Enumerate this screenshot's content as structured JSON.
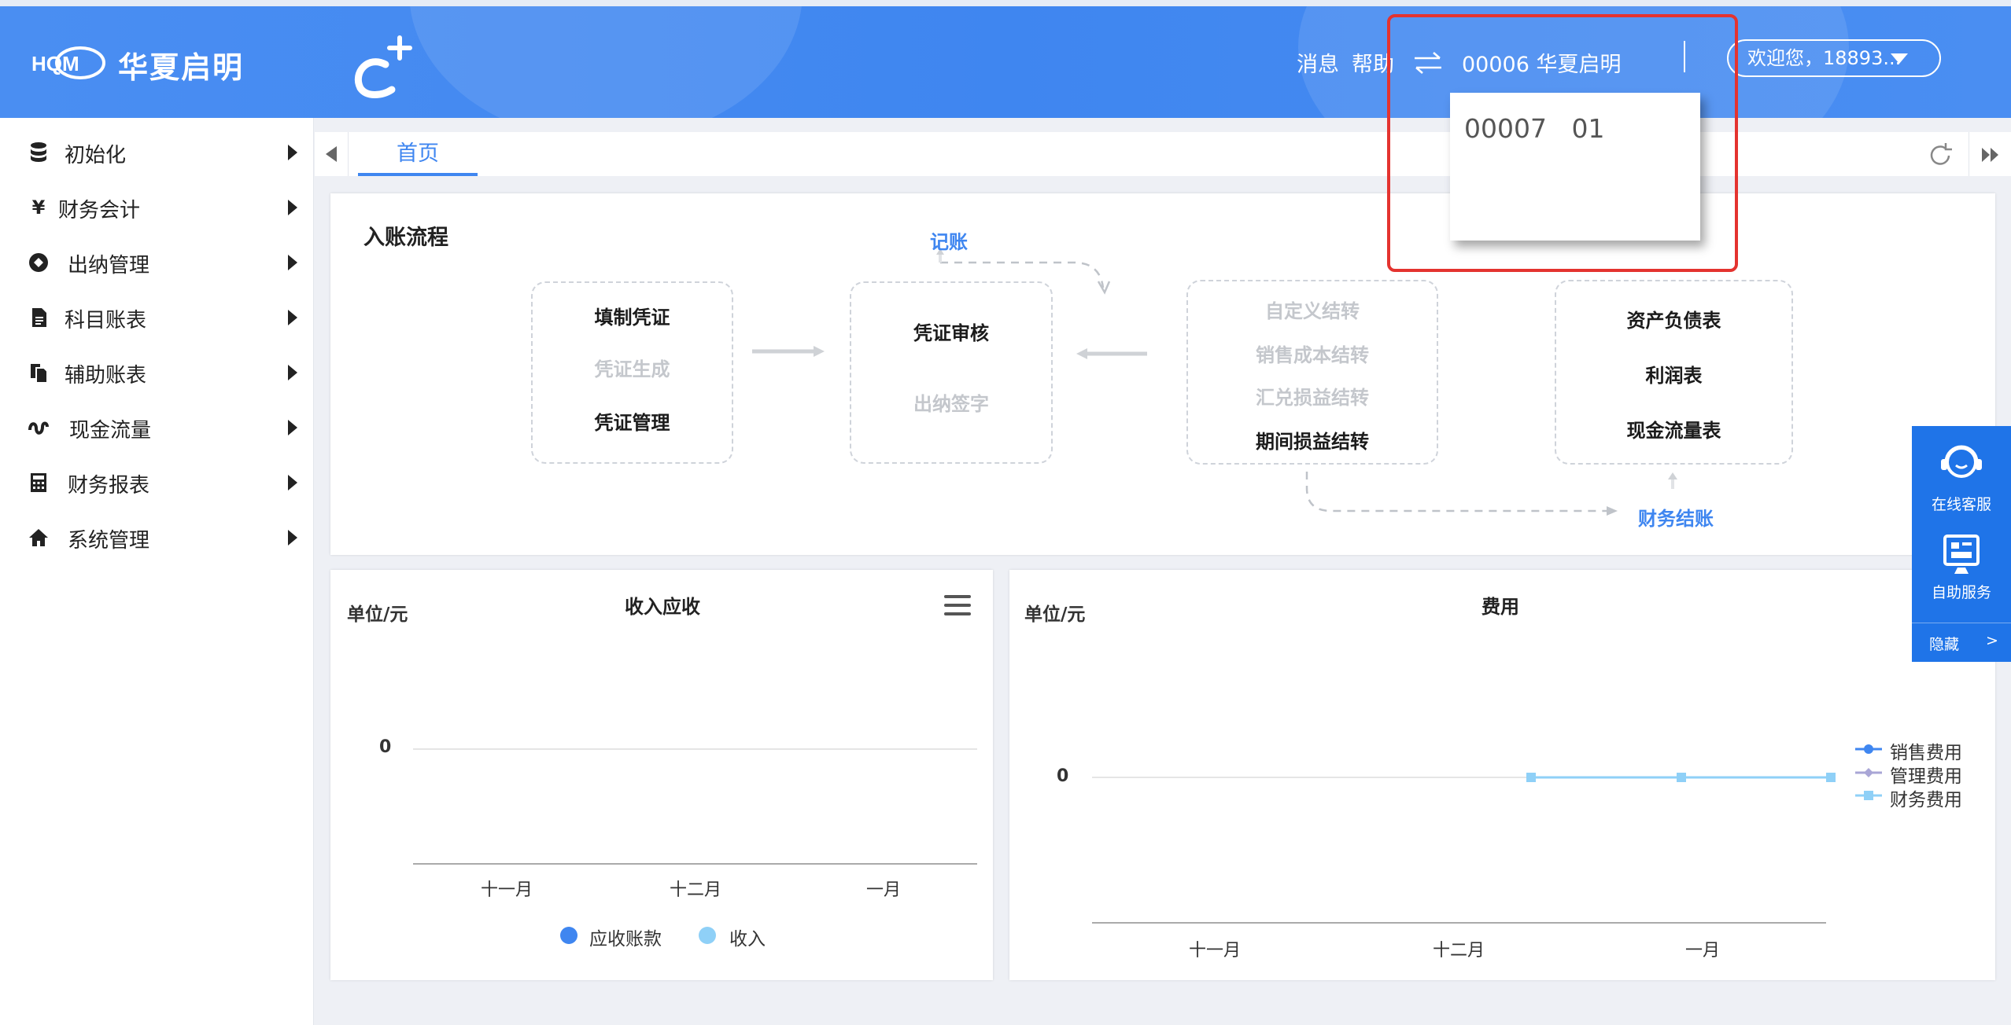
{
  "header": {
    "logo_text": "华夏启明",
    "logo_mark_text": "HQM",
    "links": [
      "消息",
      "帮助"
    ],
    "switch_icon": "swap-arrows-icon",
    "current_account": "00006 华夏启明",
    "welcome_label": "欢迎您，18893..."
  },
  "account_dropdown": {
    "options": [
      "00007   01"
    ]
  },
  "sidebar": {
    "items": [
      {
        "label": "初始化",
        "icon": "database-icon"
      },
      {
        "label": "财务会计",
        "icon": "yen-icon"
      },
      {
        "label": "出纳管理",
        "icon": "cashier-icon"
      },
      {
        "label": "科目账表",
        "icon": "document-icon"
      },
      {
        "label": "辅助账表",
        "icon": "copy-icon"
      },
      {
        "label": "现金流量",
        "icon": "flow-icon"
      },
      {
        "label": "财务报表",
        "icon": "calculator-icon"
      },
      {
        "label": "系统管理",
        "icon": "home-icon"
      }
    ]
  },
  "tabs": {
    "items": [
      "首页"
    ],
    "active": 0
  },
  "flow": {
    "title": "入账流程",
    "box1": {
      "items": [
        {
          "label": "填制凭证",
          "active": true
        },
        {
          "label": "凭证生成",
          "active": false
        },
        {
          "label": "凭证管理",
          "active": true
        }
      ]
    },
    "box2": {
      "items": [
        {
          "label": "凭证审核",
          "active": true
        },
        {
          "label": "出纳签字",
          "active": false
        }
      ]
    },
    "box3": {
      "items": [
        {
          "label": "自定义结转",
          "active": false
        },
        {
          "label": "销售成本结转",
          "active": false
        },
        {
          "label": "汇兑损益结转",
          "active": false
        },
        {
          "label": "期间损益结转",
          "active": true
        }
      ]
    },
    "box4": {
      "items": [
        {
          "label": "资产负债表",
          "active": true
        },
        {
          "label": "利润表",
          "active": true
        },
        {
          "label": "现金流量表",
          "active": true
        }
      ]
    },
    "link_record": "记账",
    "link_close": "财务结账"
  },
  "chart_data": [
    {
      "type": "bar",
      "title": "收入应收",
      "unit_label": "单位/元",
      "categories": [
        "十一月",
        "十二月",
        "一月"
      ],
      "series": [
        {
          "name": "应收账款",
          "values": [
            0,
            0,
            0
          ],
          "color": "#3f86f0"
        },
        {
          "name": "收入",
          "values": [
            0,
            0,
            0
          ],
          "color": "#8fd0f7"
        }
      ],
      "y_ticks": [
        "0"
      ],
      "legend_position": "bottom",
      "menu_icon": "hamburger-menu-icon"
    },
    {
      "type": "line",
      "title": "费用",
      "unit_label": "单位/元",
      "categories": [
        "十一月",
        "十二月",
        "一月"
      ],
      "series": [
        {
          "name": "销售费用",
          "values": [
            0,
            0,
            0
          ],
          "color": "#3f86f0"
        },
        {
          "name": "管理费用",
          "values": [
            0,
            0,
            0
          ],
          "color": "#a9a6d6"
        },
        {
          "name": "财务费用",
          "values": [
            0,
            0,
            0
          ],
          "color": "#8fd0f7"
        }
      ],
      "y_ticks": [
        "0"
      ],
      "legend_position": "right"
    }
  ],
  "float_panel": {
    "online_service": "在线客服",
    "self_service": "自助服务",
    "hide": "隐藏",
    "hide_arrow": ">"
  },
  "colors": {
    "header_blue": "#3f86f0",
    "float_blue": "#1f74e8",
    "highlight_red": "#e4332f"
  }
}
